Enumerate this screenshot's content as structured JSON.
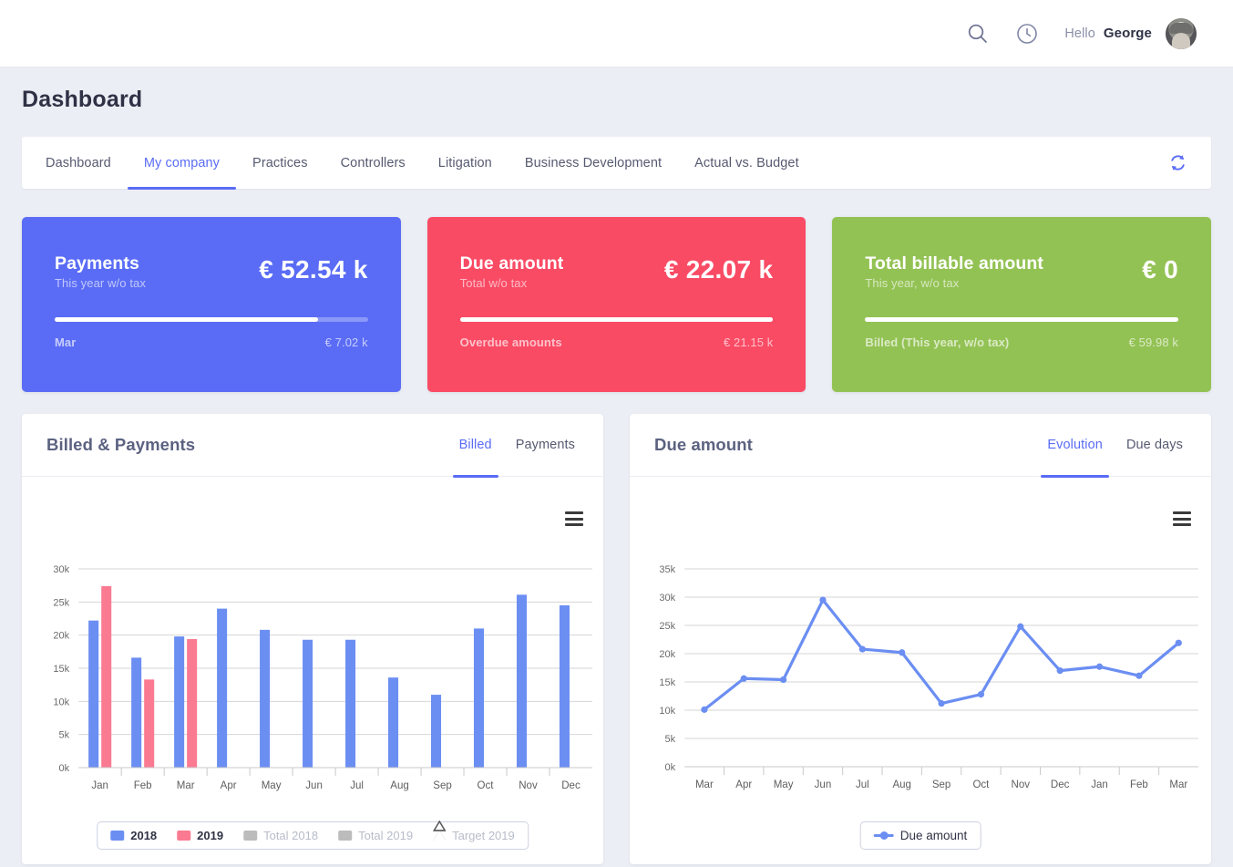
{
  "topbar": {
    "search_icon": "search-icon",
    "history_icon": "clock-icon",
    "hello_label": "Hello",
    "user_name": "George"
  },
  "page_title": "Dashboard",
  "tabs": [
    {
      "label": "Dashboard",
      "active": false
    },
    {
      "label": "My company",
      "active": true
    },
    {
      "label": "Practices",
      "active": false
    },
    {
      "label": "Controllers",
      "active": false
    },
    {
      "label": "Litigation",
      "active": false
    },
    {
      "label": "Business Development",
      "active": false
    },
    {
      "label": "Actual vs. Budget",
      "active": false
    }
  ],
  "refresh_icon": "refresh-icon",
  "kpis": [
    {
      "title": "Payments",
      "subtitle": "This year w/o tax",
      "value": "€ 52.54 k",
      "progress": 84,
      "foot_label": "Mar",
      "foot_value": "€ 7.02 k",
      "color": "#5a6cf5"
    },
    {
      "title": "Due amount",
      "subtitle": "Total w/o tax",
      "value": "€ 22.07 k",
      "progress": 100,
      "foot_label": "Overdue amounts",
      "foot_value": "€ 21.15 k",
      "color": "#fa4b65"
    },
    {
      "title": "Total billable amount",
      "subtitle": "This year, w/o tax",
      "value": "€ 0",
      "progress": 100,
      "foot_label": "Billed (This year, w/o tax)",
      "foot_value": "€ 59.98 k",
      "color": "#93c254"
    }
  ],
  "panels": {
    "billed": {
      "title": "Billed & Payments",
      "tabs": [
        {
          "label": "Billed",
          "active": true
        },
        {
          "label": "Payments",
          "active": false
        }
      ],
      "menu_icon": "hamburger-menu-icon"
    },
    "due": {
      "title": "Due amount",
      "tabs": [
        {
          "label": "Evolution",
          "active": true
        },
        {
          "label": "Due days",
          "active": false
        }
      ],
      "menu_icon": "hamburger-menu-icon"
    }
  },
  "chart_data": [
    {
      "type": "bar",
      "title": "Billed & Payments",
      "categories": [
        "Jan",
        "Feb",
        "Mar",
        "Apr",
        "May",
        "Jun",
        "Jul",
        "Aug",
        "Sep",
        "Oct",
        "Nov",
        "Dec"
      ],
      "series": [
        {
          "name": "2018",
          "color": "#6b8ef2",
          "values": [
            22200,
            16600,
            19800,
            24000,
            20800,
            19300,
            19300,
            13600,
            11000,
            21000,
            26100,
            24500
          ]
        },
        {
          "name": "2019",
          "color": "#fa7a92",
          "values": [
            27400,
            13300,
            19400,
            null,
            null,
            null,
            null,
            null,
            null,
            null,
            null,
            null
          ]
        }
      ],
      "legend": [
        {
          "label": "2018",
          "color": "#6b8ef2",
          "marker": "square",
          "enabled": true
        },
        {
          "label": "2019",
          "color": "#fa7a92",
          "marker": "square",
          "enabled": true
        },
        {
          "label": "Total 2018",
          "color": "#bcbcbc",
          "marker": "square",
          "enabled": false
        },
        {
          "label": "Total 2019",
          "color": "#bcbcbc",
          "marker": "square",
          "enabled": false
        },
        {
          "label": "Target 2019",
          "color": "#5c5c5c",
          "marker": "triangle",
          "enabled": false
        }
      ],
      "legend_position": "bottom",
      "ylim": [
        0,
        30000
      ],
      "yticks": [
        "0k",
        "5k",
        "10k",
        "15k",
        "20k",
        "25k",
        "30k"
      ],
      "ytick_values": [
        0,
        5000,
        10000,
        15000,
        20000,
        25000,
        30000
      ],
      "xlabel": "",
      "ylabel": "",
      "grid": true
    },
    {
      "type": "line",
      "title": "Due amount",
      "categories": [
        "Mar",
        "Apr",
        "May",
        "Jun",
        "Jul",
        "Aug",
        "Sep",
        "Oct",
        "Nov",
        "Dec",
        "Jan",
        "Feb",
        "Mar"
      ],
      "series": [
        {
          "name": "Due amount",
          "color": "#6b8ef2",
          "values": [
            10100,
            15600,
            15400,
            29500,
            20800,
            20200,
            11200,
            12800,
            24800,
            17000,
            17700,
            16100,
            21900
          ]
        }
      ],
      "legend": [
        {
          "label": "Due amount",
          "color": "#6b8ef2",
          "marker": "line",
          "enabled": true
        }
      ],
      "legend_position": "bottom",
      "ylim": [
        0,
        35000
      ],
      "yticks": [
        "0k",
        "5k",
        "10k",
        "15k",
        "20k",
        "25k",
        "30k",
        "35k"
      ],
      "ytick_values": [
        0,
        5000,
        10000,
        15000,
        20000,
        25000,
        30000,
        35000
      ],
      "xlabel": "",
      "ylabel": "",
      "grid": true
    }
  ]
}
